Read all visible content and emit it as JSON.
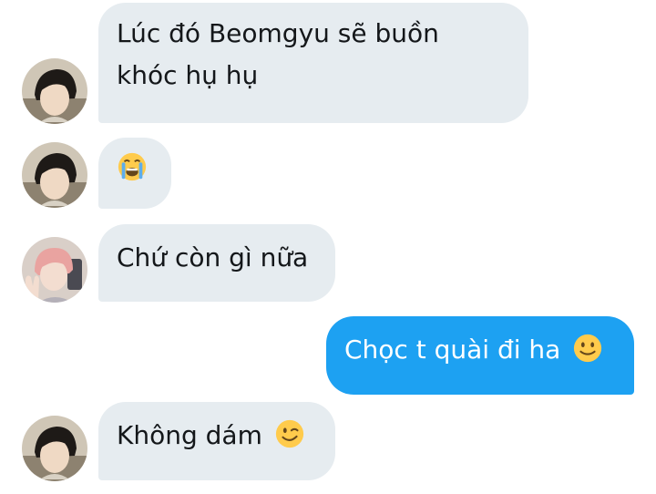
{
  "messages": [
    {
      "id": "m1",
      "direction": "received",
      "sender_avatar": "avatar-beomgyu",
      "lines": [
        "Lúc đó Beomgyu sẽ buồn",
        "khóc hụ hụ"
      ]
    },
    {
      "id": "m2",
      "direction": "received",
      "sender_avatar": "avatar-beomgyu",
      "emoji": "loudly-crying-face-emoji"
    },
    {
      "id": "m3",
      "direction": "received",
      "sender_avatar": "avatar-pink-hair",
      "text": "Chứ còn gì nữa"
    },
    {
      "id": "m4",
      "direction": "sent",
      "text": "Chọc t quài đi ha",
      "emoji": "slightly-smiling-face-emoji"
    },
    {
      "id": "m5",
      "direction": "received",
      "sender_avatar": "avatar-beomgyu",
      "text": "Không dám",
      "emoji": "winking-face-emoji"
    }
  ],
  "colors": {
    "received_bubble": "#e6ecf0",
    "sent_bubble": "#1da1f2",
    "text": "#14171a",
    "sent_text": "#ffffff"
  }
}
